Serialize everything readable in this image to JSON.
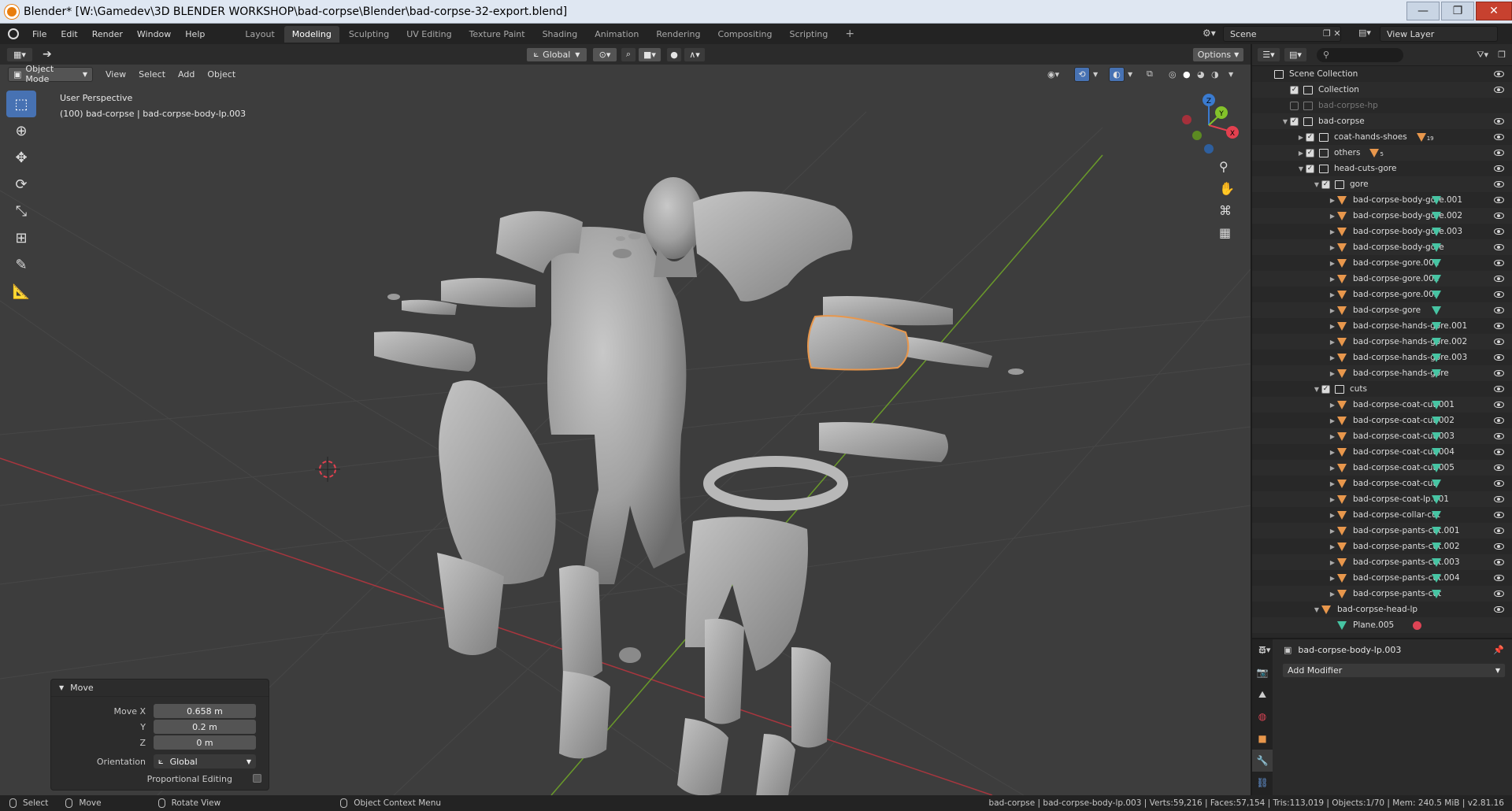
{
  "window": {
    "title": "Blender* [W:\\Gamedev\\3D BLENDER WORKSHOP\\bad-corpse\\Blender\\bad-corpse-32-export.blend]",
    "controls": [
      "—",
      "❐",
      "✕"
    ]
  },
  "menu": [
    "File",
    "Edit",
    "Render",
    "Window",
    "Help"
  ],
  "workspaces": [
    {
      "label": "Layout",
      "active": false
    },
    {
      "label": "Modeling",
      "active": true
    },
    {
      "label": "Sculpting",
      "active": false
    },
    {
      "label": "UV Editing",
      "active": false
    },
    {
      "label": "Texture Paint",
      "active": false
    },
    {
      "label": "Shading",
      "active": false
    },
    {
      "label": "Animation",
      "active": false
    },
    {
      "label": "Rendering",
      "active": false
    },
    {
      "label": "Compositing",
      "active": false
    },
    {
      "label": "Scripting",
      "active": false
    }
  ],
  "add_workspace": "+",
  "scene_field": "Scene",
  "view_layer_field": "View Layer",
  "header": {
    "orientation": "Global",
    "options": "Options"
  },
  "viewport_header": {
    "mode": "Object Mode",
    "menus": [
      "View",
      "Select",
      "Add",
      "Object"
    ]
  },
  "viewport": {
    "perspective": "User Perspective",
    "active_info": "(100) bad-corpse | bad-corpse-body-lp.003",
    "axis_labels": {
      "x": "X",
      "y": "Y",
      "z": "Z"
    }
  },
  "move_panel": {
    "title": "Move",
    "rows": [
      {
        "label": "Move X",
        "value": "0.658 m"
      },
      {
        "label": "Y",
        "value": "0.2 m"
      },
      {
        "label": "Z",
        "value": "0 m"
      }
    ],
    "orientation_label": "Orientation",
    "orientation_value": "Global",
    "proportional_label": "Proportional Editing"
  },
  "outliner": {
    "search_placeholder": "",
    "rows": [
      {
        "label": "Scene Collection",
        "type": "scene",
        "checked": null,
        "expand": "",
        "muted": false,
        "badge": null
      },
      {
        "label": "Collection",
        "type": "collection",
        "checked": true,
        "expand": "",
        "muted": false,
        "badge": null
      },
      {
        "label": "bad-corpse-hp",
        "type": "collection",
        "checked": false,
        "expand": "",
        "muted": true,
        "badge": null
      },
      {
        "label": "bad-corpse",
        "type": "collection",
        "checked": true,
        "expand": "▼",
        "muted": false,
        "badge": null
      },
      {
        "label": "coat-hands-shoes",
        "type": "collection",
        "checked": true,
        "expand": "▶",
        "muted": false,
        "badge": "19"
      },
      {
        "label": "others",
        "type": "collection",
        "checked": true,
        "expand": "▶",
        "muted": false,
        "badge": "5"
      },
      {
        "label": "head-cuts-gore",
        "type": "collection",
        "checked": true,
        "expand": "▼",
        "muted": false,
        "badge": null
      },
      {
        "label": "gore",
        "type": "collection",
        "checked": true,
        "expand": "▼",
        "muted": false,
        "badge": null
      },
      {
        "label": "bad-corpse-body-gore.001",
        "type": "mesh",
        "checked": null,
        "expand": "▶",
        "muted": false,
        "badge": null
      },
      {
        "label": "bad-corpse-body-gore.002",
        "type": "mesh",
        "checked": null,
        "expand": "▶",
        "muted": false,
        "badge": null
      },
      {
        "label": "bad-corpse-body-gore.003",
        "type": "mesh",
        "checked": null,
        "expand": "▶",
        "muted": false,
        "badge": null
      },
      {
        "label": "bad-corpse-body-gore",
        "type": "mesh",
        "checked": null,
        "expand": "▶",
        "muted": false,
        "badge": null
      },
      {
        "label": "bad-corpse-gore.001",
        "type": "mesh",
        "checked": null,
        "expand": "▶",
        "muted": false,
        "badge": null
      },
      {
        "label": "bad-corpse-gore.002",
        "type": "mesh",
        "checked": null,
        "expand": "▶",
        "muted": false,
        "badge": null
      },
      {
        "label": "bad-corpse-gore.003",
        "type": "mesh",
        "checked": null,
        "expand": "▶",
        "muted": false,
        "badge": null
      },
      {
        "label": "bad-corpse-gore",
        "type": "mesh",
        "checked": null,
        "expand": "▶",
        "muted": false,
        "badge": null
      },
      {
        "label": "bad-corpse-hands-gore.001",
        "type": "mesh",
        "checked": null,
        "expand": "▶",
        "muted": false,
        "badge": null
      },
      {
        "label": "bad-corpse-hands-gore.002",
        "type": "mesh",
        "checked": null,
        "expand": "▶",
        "muted": false,
        "badge": null
      },
      {
        "label": "bad-corpse-hands-gore.003",
        "type": "mesh",
        "checked": null,
        "expand": "▶",
        "muted": false,
        "badge": null
      },
      {
        "label": "bad-corpse-hands-gore",
        "type": "mesh",
        "checked": null,
        "expand": "▶",
        "muted": false,
        "badge": null
      },
      {
        "label": "cuts",
        "type": "collection",
        "checked": true,
        "expand": "▼",
        "muted": false,
        "badge": null
      },
      {
        "label": "bad-corpse-coat-cut.001",
        "type": "mesh",
        "checked": null,
        "expand": "▶",
        "muted": false,
        "badge": null
      },
      {
        "label": "bad-corpse-coat-cut.002",
        "type": "mesh",
        "checked": null,
        "expand": "▶",
        "muted": false,
        "badge": null
      },
      {
        "label": "bad-corpse-coat-cut.003",
        "type": "mesh",
        "checked": null,
        "expand": "▶",
        "muted": false,
        "badge": null
      },
      {
        "label": "bad-corpse-coat-cut.004",
        "type": "mesh",
        "checked": null,
        "expand": "▶",
        "muted": false,
        "badge": null
      },
      {
        "label": "bad-corpse-coat-cut.005",
        "type": "mesh",
        "checked": null,
        "expand": "▶",
        "muted": false,
        "badge": null
      },
      {
        "label": "bad-corpse-coat-cut",
        "type": "mesh",
        "checked": null,
        "expand": "▶",
        "muted": false,
        "badge": null
      },
      {
        "label": "bad-corpse-coat-lp.001",
        "type": "mesh",
        "checked": null,
        "expand": "▶",
        "muted": false,
        "badge": null
      },
      {
        "label": "bad-corpse-collar-cut",
        "type": "mesh",
        "checked": null,
        "expand": "▶",
        "muted": false,
        "badge": null
      },
      {
        "label": "bad-corpse-pants-cut.001",
        "type": "mesh",
        "checked": null,
        "expand": "▶",
        "muted": false,
        "badge": null
      },
      {
        "label": "bad-corpse-pants-cut.002",
        "type": "mesh",
        "checked": null,
        "expand": "▶",
        "muted": false,
        "badge": null
      },
      {
        "label": "bad-corpse-pants-cut.003",
        "type": "mesh",
        "checked": null,
        "expand": "▶",
        "muted": false,
        "badge": null
      },
      {
        "label": "bad-corpse-pants-cut.004",
        "type": "mesh",
        "checked": null,
        "expand": "▶",
        "muted": false,
        "badge": null
      },
      {
        "label": "bad-corpse-pants-cut",
        "type": "mesh",
        "checked": null,
        "expand": "▶",
        "muted": false,
        "badge": null
      },
      {
        "label": "bad-corpse-head-lp",
        "type": "mesh-root",
        "checked": null,
        "expand": "▼",
        "muted": false,
        "badge": null
      },
      {
        "label": "Plane.005",
        "type": "plane",
        "checked": null,
        "expand": "",
        "muted": false,
        "badge": null
      }
    ]
  },
  "properties": {
    "object_name": "bad-corpse-body-lp.003",
    "add_modifier": "Add Modifier"
  },
  "statusbar": {
    "left": [
      {
        "icon": "mouse-left-icon",
        "label": "Select"
      },
      {
        "icon": "mouse-middle-icon",
        "label": "Move"
      },
      {
        "icon": "mouse-right-icon",
        "label": "Rotate View"
      },
      {
        "icon": "mouse-right-icon",
        "label": "Object Context Menu"
      }
    ],
    "stats": "bad-corpse | bad-corpse-body-lp.003 | Verts:59,216 | Faces:57,154 | Tris:113,019 | Objects:1/70 | Mem: 240.5 MiB | v2.81.16"
  },
  "colors": {
    "selection": "#e8974c",
    "active_tool": "#4772b3",
    "mesh_data": "#47c4a3",
    "axis_x": "#e3404f",
    "axis_y": "#84c22a",
    "axis_z": "#3a7bd0"
  }
}
